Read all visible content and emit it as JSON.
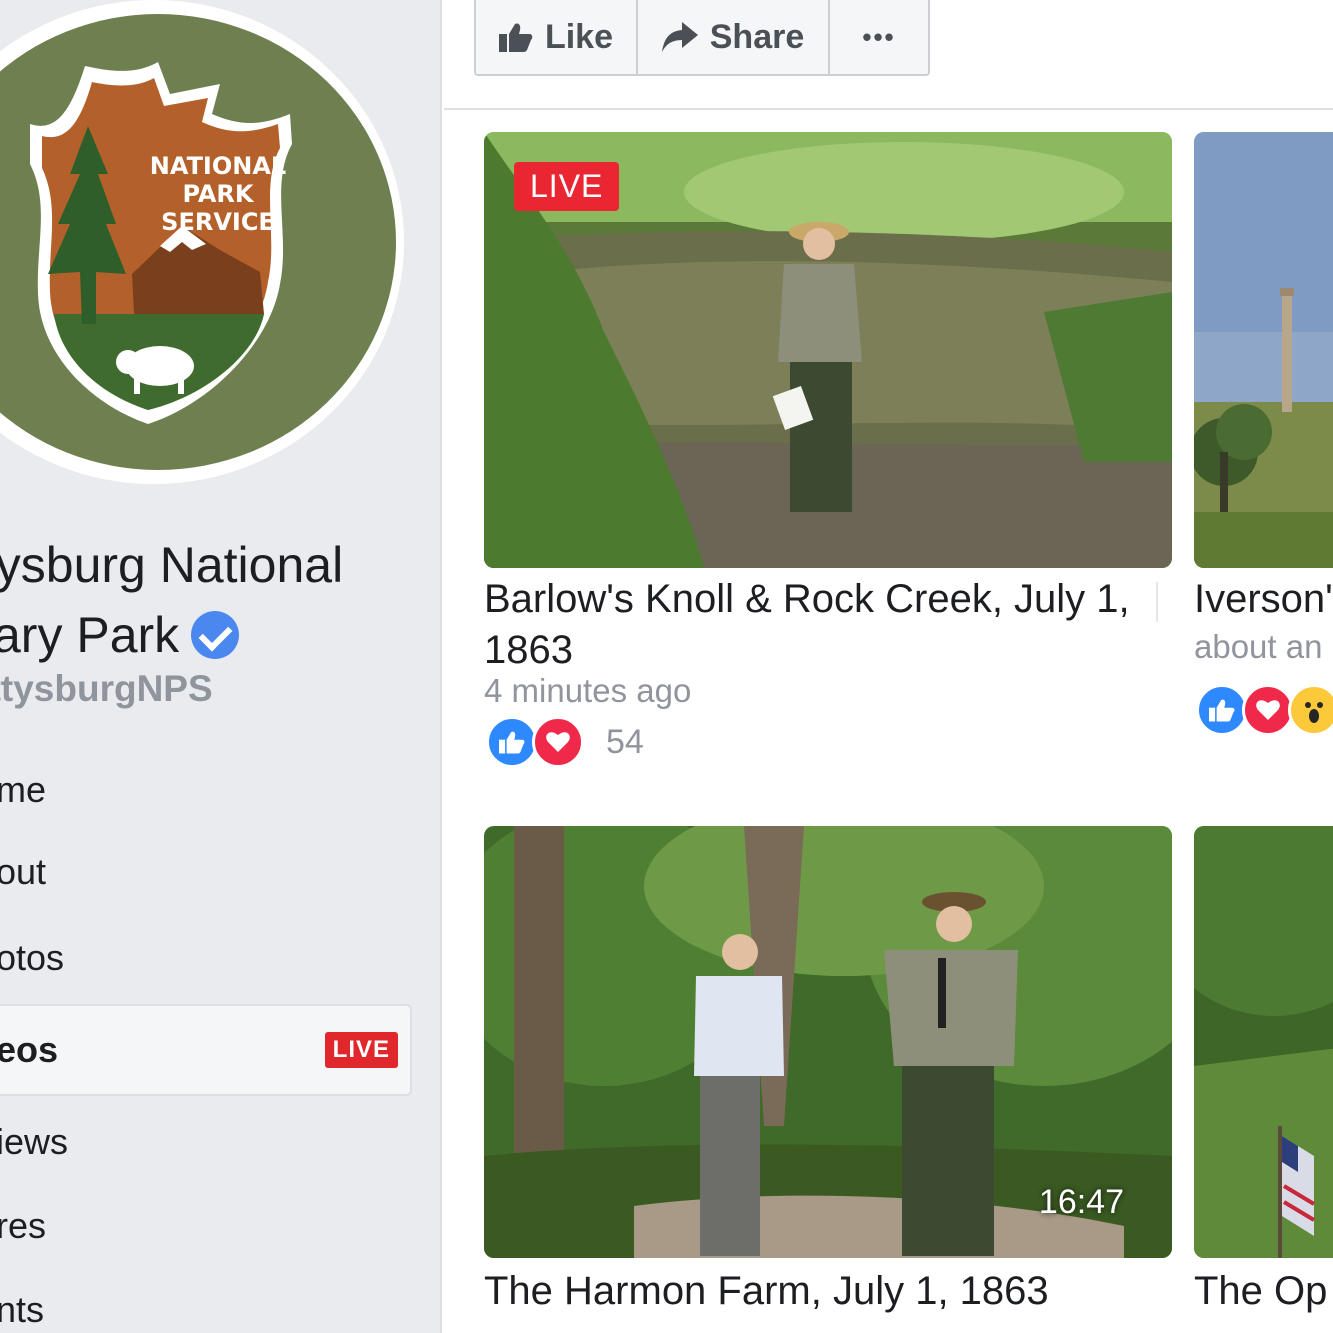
{
  "sidebar": {
    "page_name_line1": "ttysburg National",
    "page_name_line2": "itary Park",
    "handle": "ettysburgNPS",
    "avatar_text": [
      "NATIONAL",
      "PARK",
      "SERVICE"
    ],
    "nav": [
      {
        "label": "me"
      },
      {
        "label": "out"
      },
      {
        "label": "otos"
      },
      {
        "label": "eos",
        "badge": "LIVE"
      },
      {
        "label": "iews"
      },
      {
        "label": "res"
      },
      {
        "label": "nts"
      }
    ]
  },
  "toolbar": {
    "like_label": "Like",
    "share_label": "Share",
    "more_label": "•••"
  },
  "videos": [
    {
      "title": "Barlow's Knoll & Rock Creek, July 1, 1863",
      "meta": "4 minutes ago",
      "live_tag": "LIVE",
      "reactions": [
        "like-icon",
        "love-icon"
      ],
      "reaction_count": "54"
    },
    {
      "title": "Iverson'",
      "meta": "about an",
      "reactions": [
        "like-icon",
        "love-icon",
        "wow-icon"
      ]
    },
    {
      "title": "The Harmon Farm, July 1, 1863",
      "duration": "16:47"
    },
    {
      "title": "The Op"
    }
  ],
  "colors": {
    "sidebar_bg": "#e9ebee",
    "live_red": "#eb2633",
    "verified_blue": "#4a88f0",
    "nps_green": "#6e8050",
    "nps_brown": "#b4602a"
  }
}
